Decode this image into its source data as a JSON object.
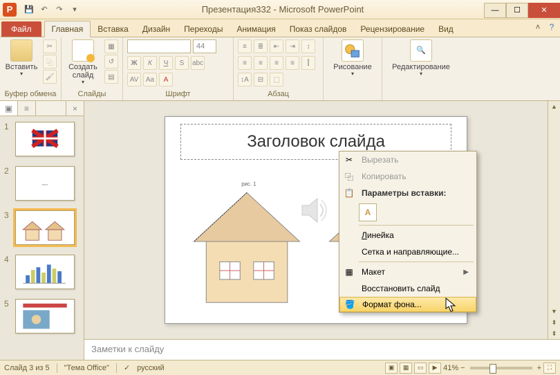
{
  "app": {
    "title": "Презентация332 - Microsoft PowerPoint",
    "letter": "P"
  },
  "tabs": {
    "file": "Файл",
    "items": [
      "Главная",
      "Вставка",
      "Дизайн",
      "Переходы",
      "Анимация",
      "Показ слайдов",
      "Рецензирование",
      "Вид"
    ],
    "active": 0
  },
  "ribbon": {
    "clipboard": {
      "paste": "Вставить",
      "label": "Буфер обмена"
    },
    "slides": {
      "new": "Создать\nслайд",
      "label": "Слайды"
    },
    "font": {
      "size": "44",
      "label": "Шрифт"
    },
    "para": {
      "label": "Абзац"
    },
    "drawing": {
      "btn": "Рисование",
      "label": ""
    },
    "editing": {
      "btn": "Редактирование",
      "label": ""
    }
  },
  "thumbs": {
    "count": 5,
    "selected": 3
  },
  "slide": {
    "title": "Заголовок слайда"
  },
  "notes": {
    "placeholder": "Заметки к слайду"
  },
  "context": {
    "cut": "Вырезать",
    "copy": "Копировать",
    "pasteHeader": "Параметры вставки:",
    "pasteOpt": "A",
    "ruler": "Линейка",
    "grid": "Сетка и направляющие...",
    "layout": "Макет",
    "reset": "Восстановить слайд",
    "formatbg": "Формат фона..."
  },
  "status": {
    "slide": "Слайд 3 из 5",
    "theme": "\"Тема Office\"",
    "lang": "русский",
    "zoom": "41%"
  }
}
